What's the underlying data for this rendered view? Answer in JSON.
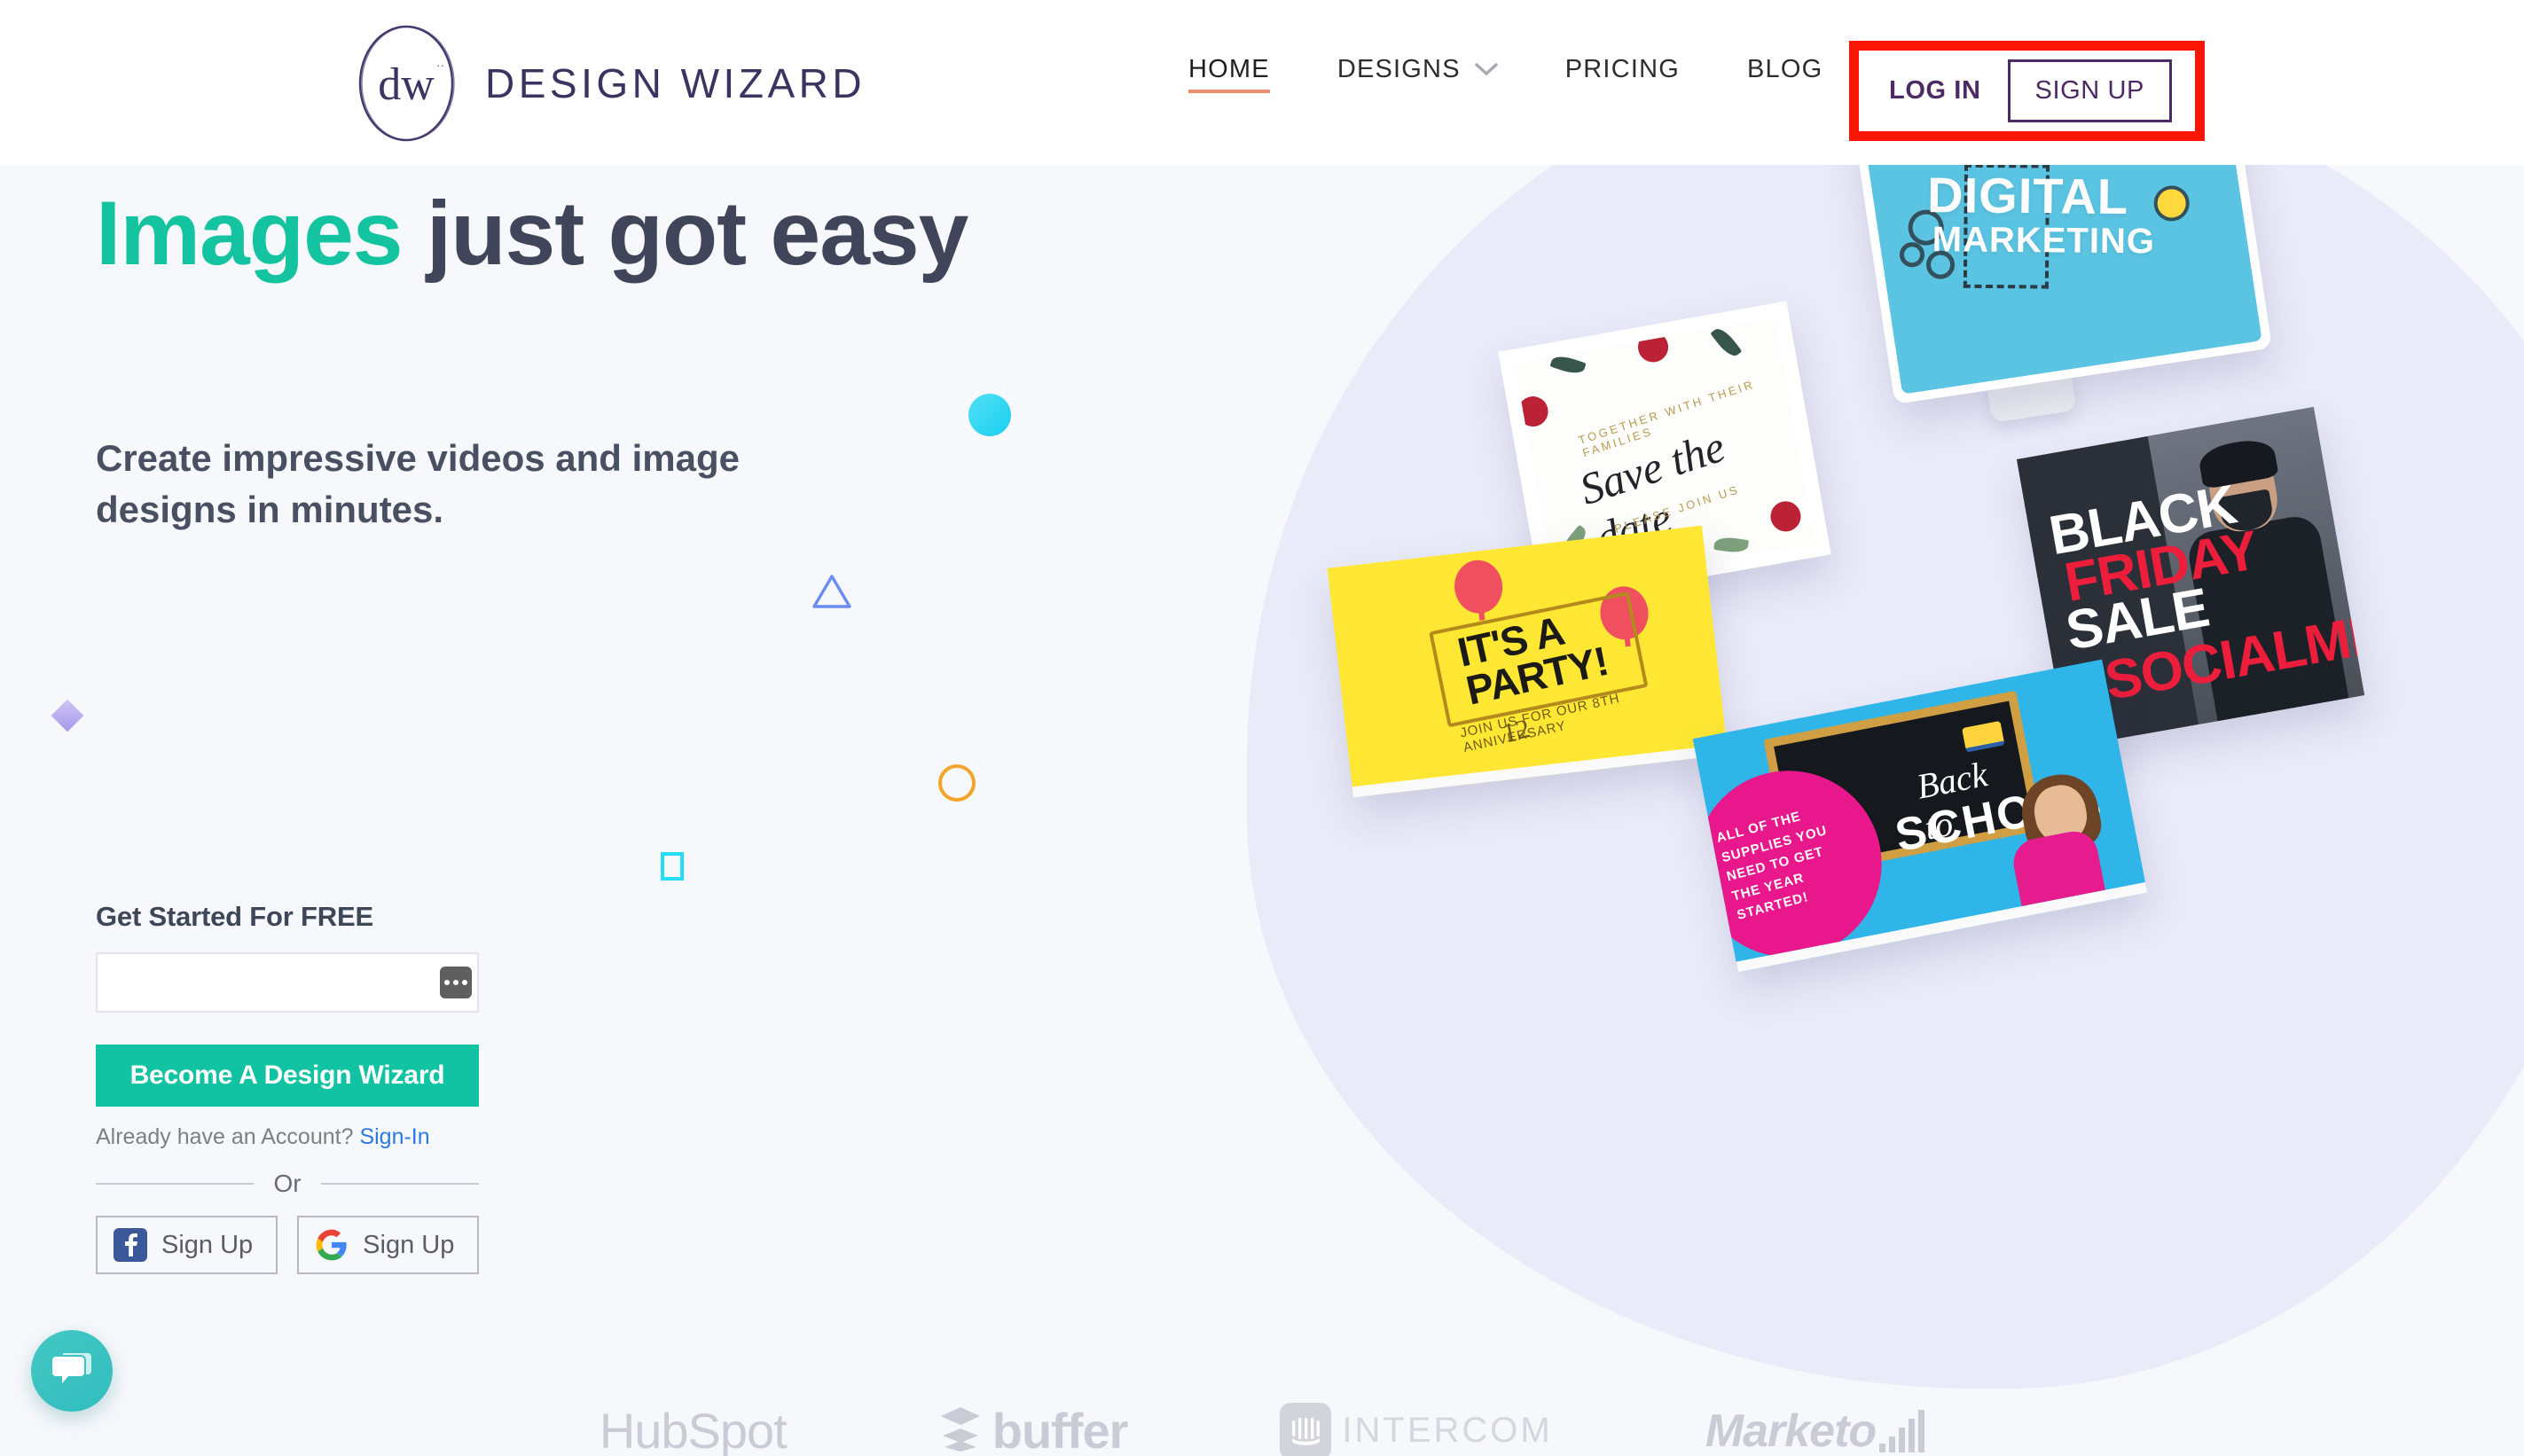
{
  "brand": {
    "logo_monogram": "dw",
    "logo_text": "DESIGN WIZARD",
    "accent_teal": "#11c3a3",
    "accent_coral": "#ef8f72",
    "purple": "#4c2a63",
    "annotation_red": "#fa1505"
  },
  "nav": {
    "items": [
      {
        "label": "HOME",
        "active": true,
        "caret": false
      },
      {
        "label": "DESIGNS",
        "active": false,
        "caret": true
      },
      {
        "label": "PRICING",
        "active": false,
        "caret": false
      },
      {
        "label": "BLOG",
        "active": false,
        "caret": false
      }
    ],
    "login_label": "LOG IN",
    "signup_label": "SIGN UP"
  },
  "hero": {
    "headline_accent": "Images",
    "headline_rest": " just got easy",
    "subhead": "Create impressive videos and image designs in minutes.",
    "shapes": [
      {
        "name": "teal-dot",
        "color": "#2bd4f2"
      },
      {
        "name": "blue-triangle",
        "color": "#6c8cf5"
      },
      {
        "name": "orange-circle",
        "color": "#f3a52b"
      },
      {
        "name": "cyan-square",
        "color": "#22dff7"
      },
      {
        "name": "purple-diamond",
        "color": "#b0a3ef"
      }
    ]
  },
  "form": {
    "label": "Get Started For FREE",
    "email_value": "",
    "email_placeholder": "",
    "password_badge_icon": "password-dots-icon",
    "cta_label": "Become A Design Wizard",
    "already_text": "Already have an Account?",
    "signin_link": "Sign-In",
    "or_text": "Or",
    "facebook_label": "Sign Up",
    "google_label": "Sign Up"
  },
  "collage": {
    "monitor": {
      "title": "DIGITAL",
      "subtitle": "MARKETING"
    },
    "save_the_date": {
      "script": "Save the date",
      "top_small": "TOGETHER WITH THEIR FAMILIES",
      "bottom_small": "PLEASE JOIN US"
    },
    "party": {
      "title_line1": "IT'S A",
      "title_line2": "PARTY!",
      "small": "JOIN US FOR OUR 8TH ANNIVERSARY",
      "number": "12"
    },
    "black_friday": {
      "line1": "BLACK",
      "line2": "FRIDAY",
      "line3": "SALE",
      "tag": "#SOCIALMEDIA"
    },
    "back_to_school": {
      "script": "Back to",
      "block": "SCHOOL",
      "pink_text": "ALL OF THE SUPPLIES YOU NEED TO GET THE YEAR STARTED!"
    }
  },
  "partners": [
    {
      "name": "HubSpot",
      "icon": "hubspot-logo"
    },
    {
      "name": "buffer",
      "icon": "buffer-logo"
    },
    {
      "name": "INTERCOM",
      "icon": "intercom-logo"
    },
    {
      "name": "Marketo",
      "icon": "marketo-logo"
    }
  ],
  "chat": {
    "icon": "chat-bubbles-icon",
    "color": "#37c3c0"
  }
}
